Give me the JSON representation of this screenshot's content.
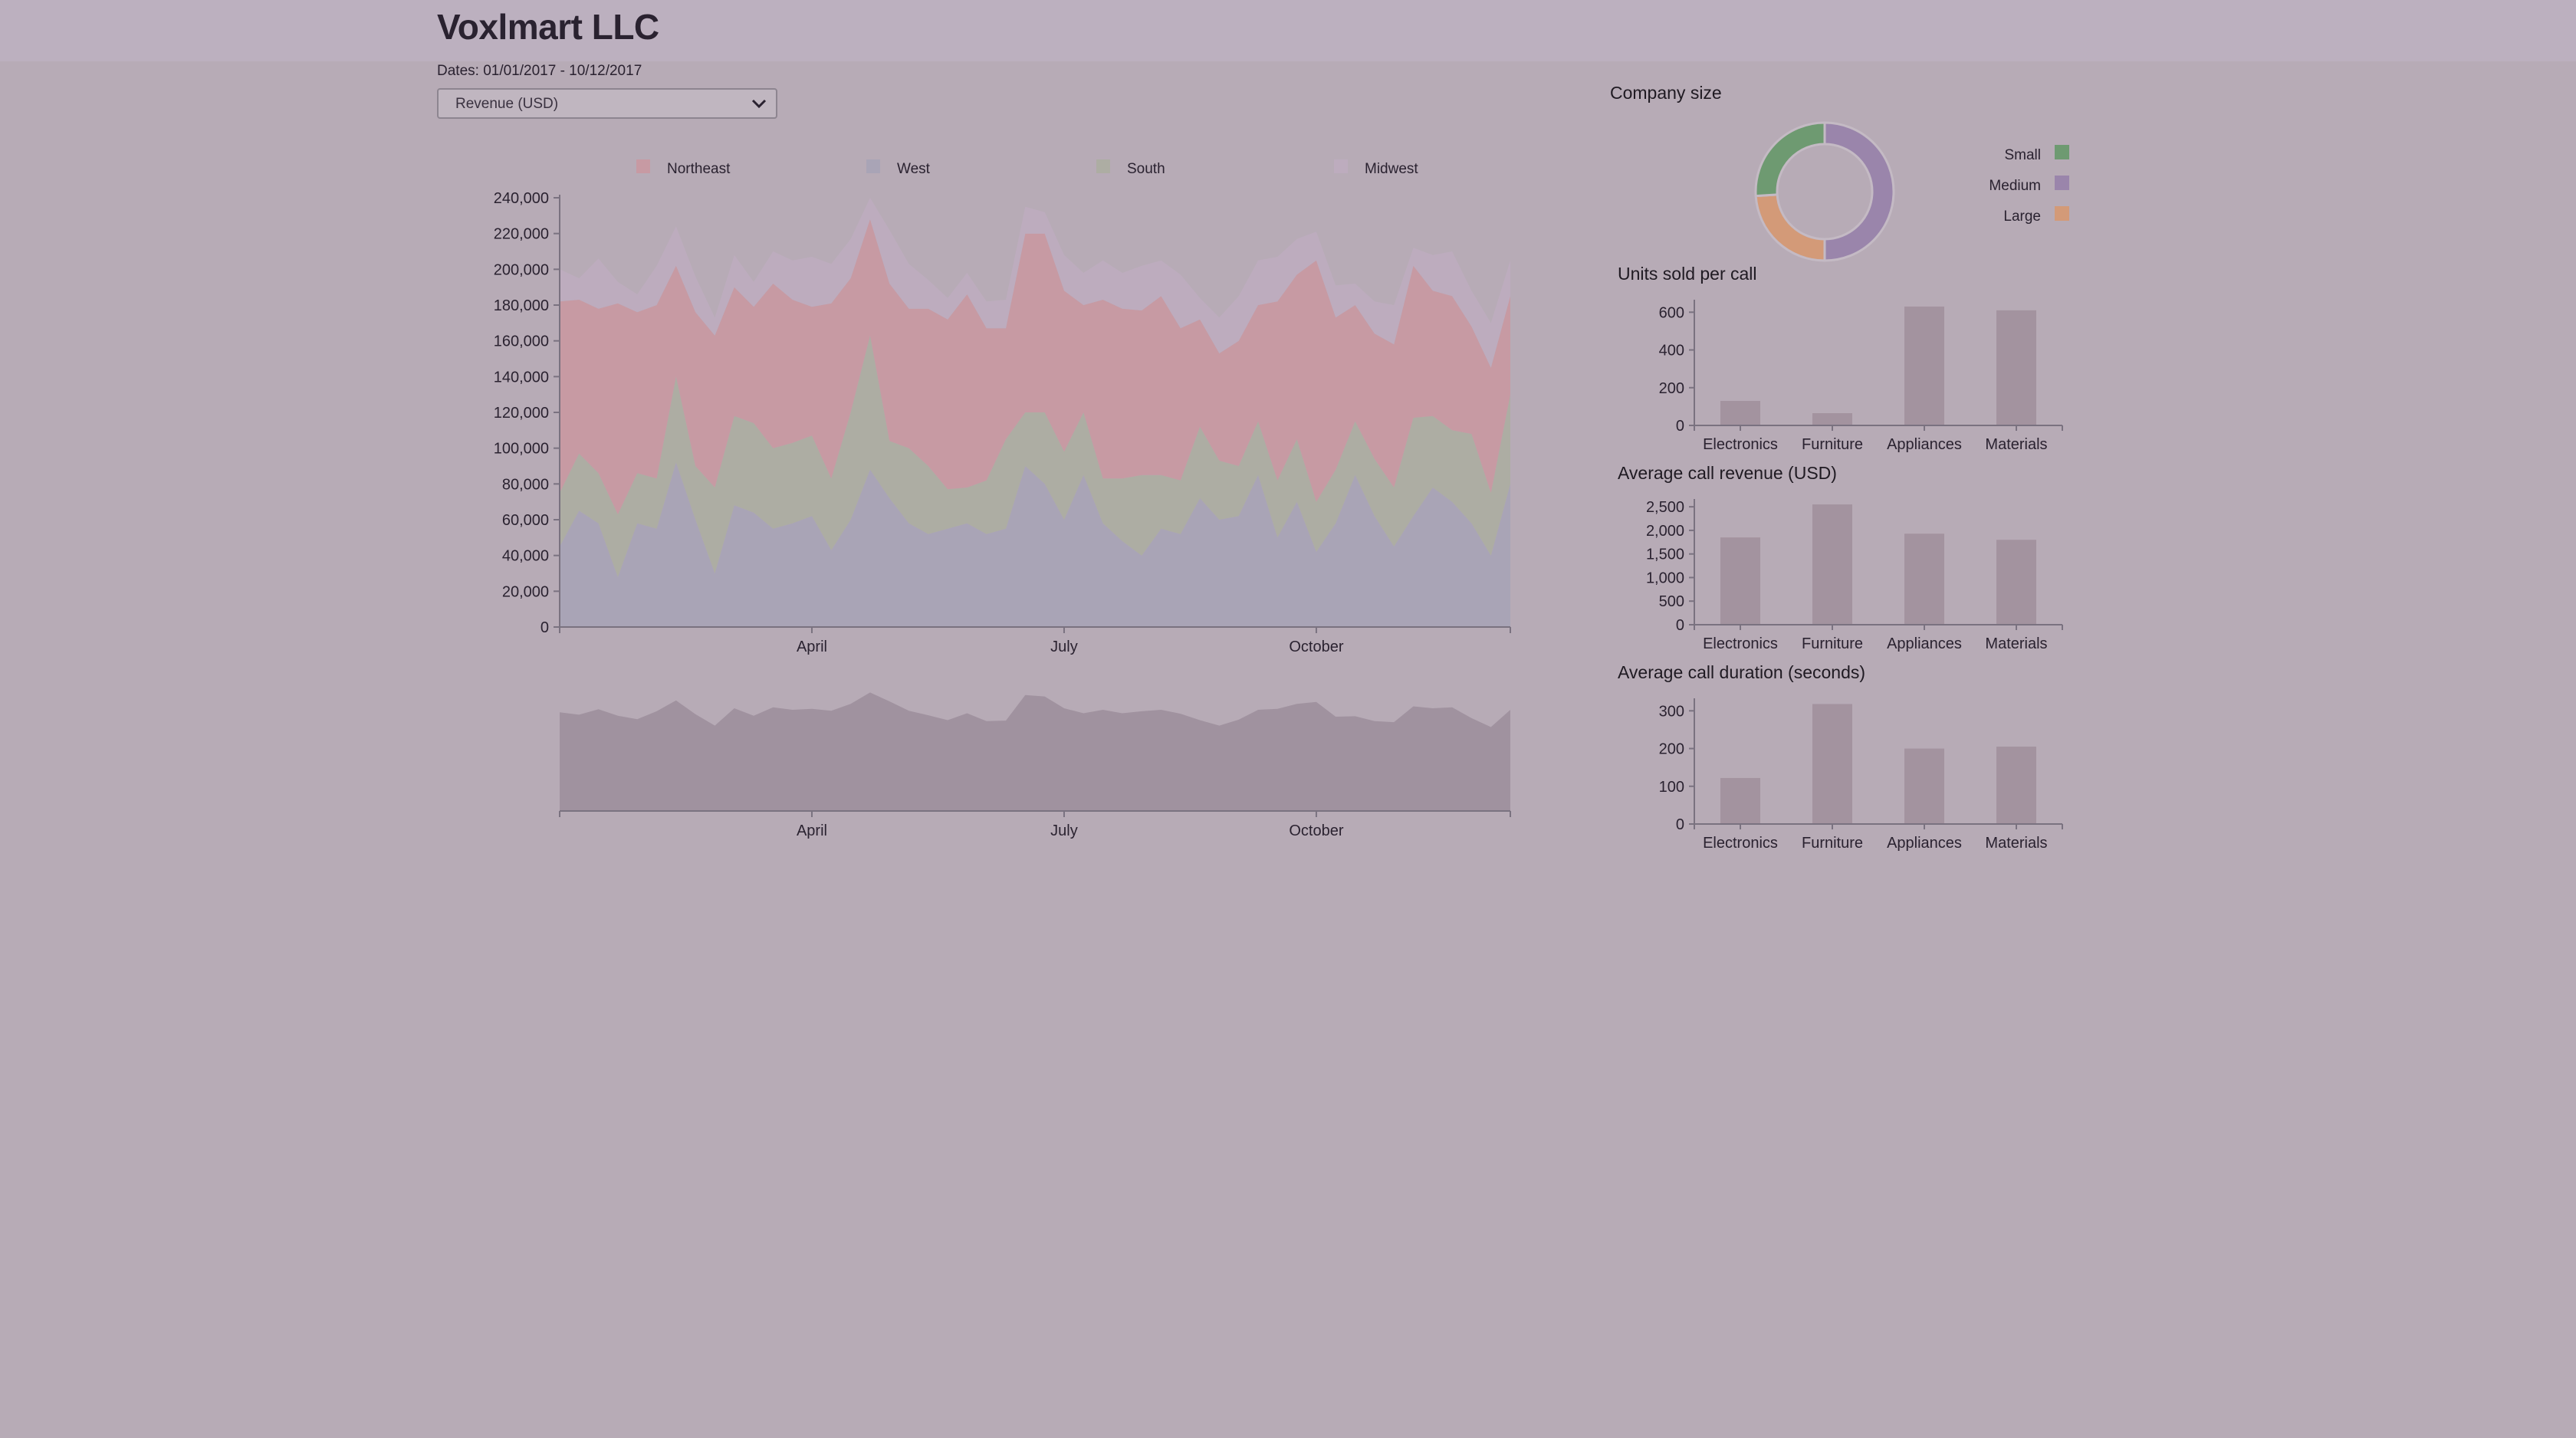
{
  "header": {
    "title": "Voxlmart LLC"
  },
  "controls": {
    "dates_label": "Dates: 01/01/2017 - 10/12/2017",
    "metric_select": "Revenue (USD)"
  },
  "colors": {
    "Northeast": "#c79aa3",
    "West": "#a9a4b6",
    "South": "#adada3",
    "Midwest": "#bdacbe",
    "brush": "#a0929f",
    "bar": "#a3939f",
    "small": "#6e9a71",
    "medium": "#9a85ab",
    "large": "#d39a78"
  },
  "chart_data": [
    {
      "type": "area",
      "stacked": true,
      "legend": [
        "Northeast",
        "West",
        "South",
        "Midwest"
      ],
      "legend_position": "top",
      "ylim": [
        0,
        240000
      ],
      "yticks": [
        "0",
        "20,000",
        "40,000",
        "60,000",
        "80,000",
        "100,000",
        "120,000",
        "140,000",
        "160,000",
        "180,000",
        "200,000",
        "220,000",
        "240,000"
      ],
      "xticks": [
        "April",
        "July",
        "October"
      ],
      "xtick_positions": [
        13,
        26,
        39
      ],
      "n_points": 50,
      "series": [
        {
          "name": "West",
          "values": [
            45000,
            65000,
            58000,
            28000,
            58000,
            55000,
            92000,
            60000,
            30000,
            68000,
            64000,
            55000,
            58000,
            62000,
            43000,
            60000,
            88000,
            72000,
            58000,
            52000,
            55000,
            58000,
            52000,
            55000,
            90000,
            80000,
            60000,
            85000,
            58000,
            48000,
            40000,
            55000,
            52000,
            72000,
            60000,
            62000,
            85000,
            50000,
            70000,
            42000,
            58000,
            85000,
            62000,
            45000,
            62000,
            78000,
            70000,
            58000,
            40000,
            80000
          ]
        },
        {
          "name": "South",
          "values": [
            30000,
            32000,
            28000,
            35000,
            28000,
            28000,
            48000,
            30000,
            48000,
            50000,
            50000,
            45000,
            45000,
            45000,
            40000,
            60000,
            75000,
            32000,
            42000,
            38000,
            22000,
            20000,
            30000,
            50000,
            30000,
            40000,
            38000,
            35000,
            25000,
            35000,
            45000,
            30000,
            30000,
            40000,
            33000,
            28000,
            30000,
            32000,
            35000,
            28000,
            30000,
            30000,
            32000,
            33000,
            55000,
            40000,
            40000,
            50000,
            35000,
            50000
          ]
        },
        {
          "name": "Northeast",
          "values": [
            107000,
            86000,
            92000,
            118000,
            90000,
            97000,
            62000,
            86000,
            85000,
            72000,
            65000,
            92000,
            80000,
            72000,
            98000,
            75000,
            65000,
            88000,
            78000,
            88000,
            95000,
            108000,
            85000,
            62000,
            100000,
            100000,
            90000,
            60000,
            100000,
            95000,
            92000,
            100000,
            85000,
            60000,
            60000,
            70000,
            65000,
            100000,
            92000,
            135000,
            85000,
            65000,
            70000,
            80000,
            85000,
            70000,
            75000,
            60000,
            70000,
            55000
          ]
        },
        {
          "name": "Midwest",
          "values": [
            18000,
            12000,
            28000,
            12000,
            10000,
            22000,
            22000,
            20000,
            10000,
            18000,
            14000,
            18000,
            22000,
            28000,
            22000,
            22000,
            12000,
            30000,
            25000,
            16000,
            12000,
            12000,
            15000,
            16000,
            15000,
            12000,
            20000,
            18000,
            22000,
            20000,
            25000,
            20000,
            30000,
            12000,
            20000,
            25000,
            25000,
            25000,
            20000,
            16000,
            18000,
            12000,
            18000,
            22000,
            10000,
            20000,
            25000,
            20000,
            25000,
            20000
          ]
        }
      ]
    },
    {
      "type": "area",
      "role": "brush-overview",
      "xticks": [
        "April",
        "July",
        "October"
      ]
    },
    {
      "type": "pie",
      "title": "Company size",
      "categories": [
        "Small",
        "Medium",
        "Large"
      ],
      "values": [
        26,
        50,
        24
      ]
    },
    {
      "type": "bar",
      "title": "Units sold per call",
      "categories": [
        "Electronics",
        "Furniture",
        "Appliances",
        "Materials"
      ],
      "values": [
        130,
        65,
        630,
        610
      ],
      "ylim": [
        0,
        650
      ],
      "yticks": [
        "0",
        "200",
        "400",
        "600"
      ],
      "ytick_values": [
        0,
        200,
        400,
        600
      ]
    },
    {
      "type": "bar",
      "title": "Average call revenue (USD)",
      "categories": [
        "Electronics",
        "Furniture",
        "Appliances",
        "Materials"
      ],
      "values": [
        1850,
        2550,
        1930,
        1800
      ],
      "ylim": [
        0,
        2600
      ],
      "yticks": [
        "0",
        "500",
        "1,000",
        "1,500",
        "2,000",
        "2,500"
      ],
      "ytick_values": [
        0,
        500,
        1000,
        1500,
        2000,
        2500
      ]
    },
    {
      "type": "bar",
      "title": "Average call duration (seconds)",
      "categories": [
        "Electronics",
        "Furniture",
        "Appliances",
        "Materials"
      ],
      "values": [
        122,
        318,
        200,
        205
      ],
      "ylim": [
        0,
        325
      ],
      "yticks": [
        "0",
        "100",
        "200",
        "300"
      ],
      "ytick_values": [
        0,
        100,
        200,
        300
      ]
    }
  ]
}
